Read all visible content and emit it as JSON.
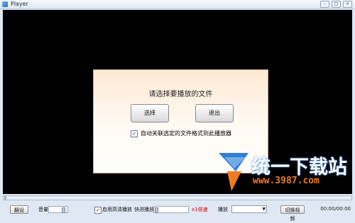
{
  "window": {
    "title": "Player",
    "min_icon": "minimize-icon",
    "max_icon": "maximize-icon",
    "close_icon": "close-icon"
  },
  "dialog": {
    "prompt": "请选择要播放的文件",
    "select_label": "选择",
    "exit_label": "退出",
    "assoc_checked": true,
    "assoc_label": "自动关联选定的文件格式到此播放器"
  },
  "watermark": {
    "title": "统一下载站",
    "url": "www.3987.com"
  },
  "controls": {
    "progress": 0,
    "subtitle_label": "翻设",
    "volume_label": "音量",
    "hq_checked": true,
    "hq_label": "启用高清播放",
    "speed_label": "快进播放",
    "speed_value": "x1倍速",
    "subtitle_select_label": "播放",
    "switch_video_label": "切换视频",
    "time": "00:00/00:00"
  },
  "colors": {
    "video_bg": "#000000",
    "speed_text": "#e00000",
    "watermark_url": "#f07a1e"
  }
}
